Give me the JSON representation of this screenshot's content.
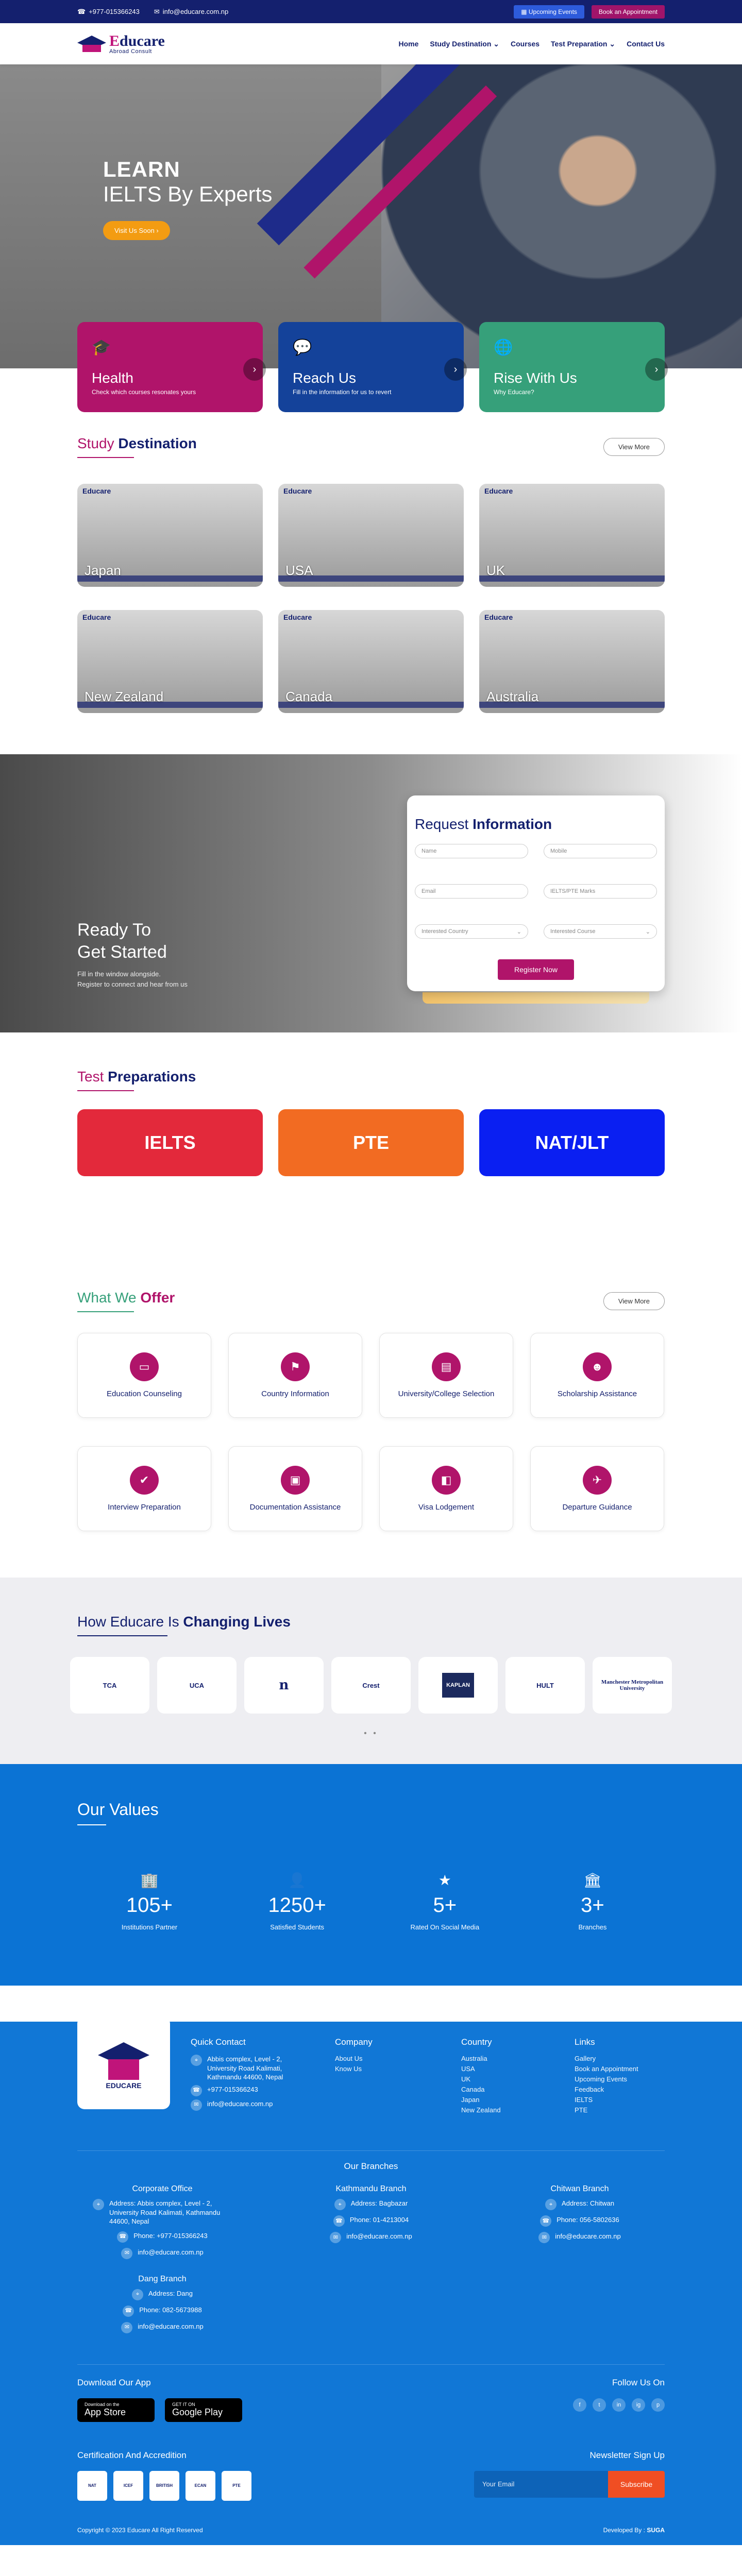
{
  "topbar": {
    "phone": "+977-015366243",
    "email": "info@educare.com.np",
    "events_label": "Upcoming Events",
    "appointment_label": "Book an Appointment"
  },
  "logo": {
    "name_a": "E",
    "name_b": "ducare",
    "tagline": "Abroad Consult"
  },
  "nav": {
    "items": [
      "Home",
      "Study Destination ⌄",
      "Courses",
      "Test Preparation ⌄",
      "Contact Us"
    ]
  },
  "hero": {
    "line1": "LEARN",
    "line2": "IELTS By Experts",
    "button": "Visit Us Soon"
  },
  "cards": [
    {
      "title": "Health",
      "text": "Check which courses resonates yours",
      "icon": "graduation-cap-icon"
    },
    {
      "title": "Reach Us",
      "text": "Fill in the information for us to revert",
      "icon": "chat-icon"
    },
    {
      "title": "Rise With Us",
      "text": "Why Educare?",
      "icon": "globe-icon"
    }
  ],
  "destination": {
    "title_a": "Study",
    "title_b": "Destination",
    "view_more": "View More",
    "items": [
      "Japan",
      "USA",
      "UK",
      "New Zealand",
      "Canada",
      "Australia"
    ],
    "brand": "Educare"
  },
  "request": {
    "heading_a": "Ready To",
    "heading_b": "Get Started",
    "sub_a": "Fill in the window alongside.",
    "sub_b": "Register to connect and hear from us",
    "form_title_a": "Request",
    "form_title_b": "Information",
    "fields": [
      "Name",
      "Mobile",
      "Email",
      "IELTS/PTE Marks",
      "Interested Country",
      "Interested Course"
    ],
    "submit": "Register Now"
  },
  "prep": {
    "title_a": "Test",
    "title_b": "Preparations",
    "items": [
      "IELTS",
      "PTE",
      "NAT/JLT"
    ]
  },
  "offer": {
    "title_a": "What We",
    "title_b": "Offer",
    "view_more": "View More",
    "items": [
      "Education Counseling",
      "Country Information",
      "University/College Selection",
      "Scholarship Assistance",
      "Interview Preparation",
      "Documentation Assistance",
      "Visa Lodgement",
      "Departure Guidance"
    ]
  },
  "changing": {
    "title_a": "How Educare Is",
    "title_b": "Changing Lives",
    "logos": [
      "TCA",
      "UCA",
      "n",
      "Crest",
      "KAPLAN",
      "HULT",
      "Manchester Metropolitan University"
    ],
    "dots": "• •"
  },
  "values": {
    "title": "Our Values",
    "items": [
      {
        "num": "105+",
        "label": "Institutions Partner"
      },
      {
        "num": "1250+",
        "label": "Satisfied Students"
      },
      {
        "num": "5+",
        "label": "Rated On Social Media"
      },
      {
        "num": "3+",
        "label": "Branches"
      }
    ]
  },
  "footer": {
    "logo_text": "EDUCARE",
    "quick_contact": {
      "title": "Quick Contact",
      "address": "Abbis complex, Level - 2, University Road Kalimati, Kathmandu 44600, Nepal",
      "phone": "+977-015366243",
      "email": "info@educare.com.np"
    },
    "company": {
      "title": "Company",
      "items": [
        "About Us",
        "Know Us"
      ]
    },
    "country": {
      "title": "Country",
      "items": [
        "Australia",
        "USA",
        "UK",
        "Canada",
        "Japan",
        "New Zealand"
      ]
    },
    "links": {
      "title": "Links",
      "items": [
        "Gallery",
        "Book an Appointment",
        "Upcoming Events",
        "Feedback",
        "IELTS",
        "PTE"
      ]
    },
    "branches_title": "Our Branches",
    "branches": [
      {
        "name": "Corporate Office",
        "address": "Address: Abbis complex, Level - 2, University Road Kalimati, Kathmandu 44600, Nepal",
        "phone": "Phone: +977-015366243",
        "email": "info@educare.com.np"
      },
      {
        "name": "Kathmandu Branch",
        "address": "Address: Bagbazar",
        "phone": "Phone: 01-4213004",
        "email": "info@educare.com.np"
      },
      {
        "name": "Chitwan Branch",
        "address": "Address: Chitwan",
        "phone": "Phone: 056-5802636",
        "email": "info@educare.com.np"
      },
      {
        "name": "Dang Branch",
        "address": "Address: Dang",
        "phone": "Phone: 082-5673988",
        "email": "info@educare.com.np"
      }
    ],
    "download_title": "Download Our App",
    "app_store_small": "Download on the",
    "app_store": "App Store",
    "google_play_small": "GET IT ON",
    "google_play": "Google Play",
    "follow_title": "Follow Us On",
    "social": [
      "f",
      "t",
      "in",
      "ig",
      "p"
    ],
    "cert_title": "Certification And Accredition",
    "certs": [
      "NAT",
      "ICEF",
      "BRITISH",
      "ECAN",
      "PTE"
    ],
    "newsletter_title": "Newsletter Sign Up",
    "newsletter_placeholder": "Your Email",
    "subscribe": "Subscribe",
    "copyright": "Copyright © 2023 Educare All Right Reserved",
    "developed_by": "Developed By :",
    "developer": "SUGA"
  },
  "colors": {
    "navy": "#14206e",
    "magenta": "#b0146a",
    "green": "#36a07a",
    "blue": "#0b73d4"
  }
}
